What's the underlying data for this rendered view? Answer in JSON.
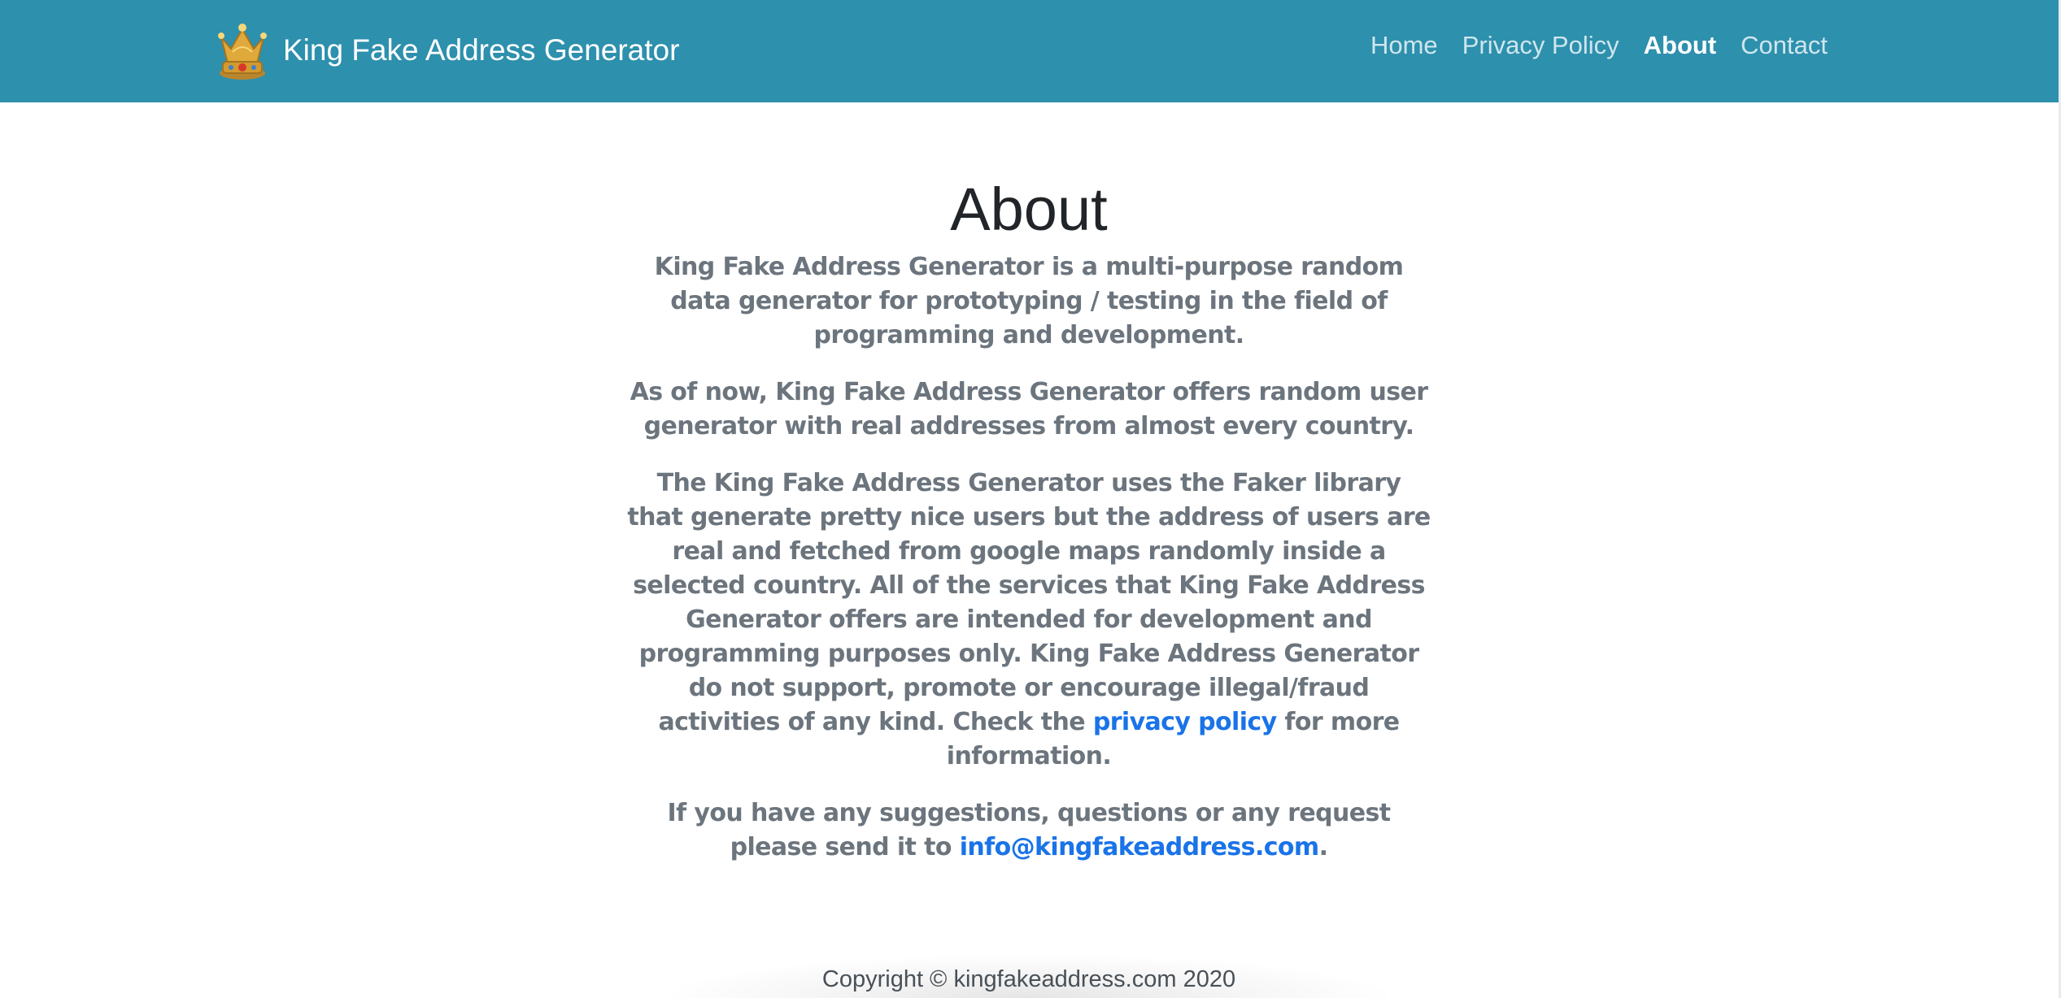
{
  "navbar": {
    "brand_icon": "crown-icon",
    "brand_name": "King Fake Address Generator",
    "background_color": "#2d90ad",
    "links": [
      {
        "label": "Home",
        "active": false
      },
      {
        "label": "Privacy Policy",
        "active": false
      },
      {
        "label": "About",
        "active": true
      },
      {
        "label": "Contact",
        "active": false
      }
    ]
  },
  "main": {
    "title": "About",
    "p1": {
      "bold": "King Fake Address Generator",
      "rest": " is a multi-purpose random data generator for prototyping / testing in the field of programming and development."
    },
    "p2": "As of now, King Fake Address Generator offers random user generator with real addresses from almost every country.",
    "p3": {
      "text": "The King Fake Address Generator uses the Faker library that generate pretty nice users but the address of users are real and fetched from google maps randomly inside a selected country. All of the services that King Fake Address Generator offers are intended for development and programming purposes only. King Fake Address Generator do not support, promote or encourage illegal/fraud activities of any kind. Check the ",
      "link": "privacy policy",
      "after": " for more information."
    },
    "p4": {
      "text": "If you have any suggestions, questions or any request please send it to ",
      "link": "info@kingfakeaddress.com",
      "after": "."
    },
    "link_color": "#1a73e8"
  },
  "footer": {
    "copyright": "Copyright © kingfakeaddress.com 2020"
  }
}
